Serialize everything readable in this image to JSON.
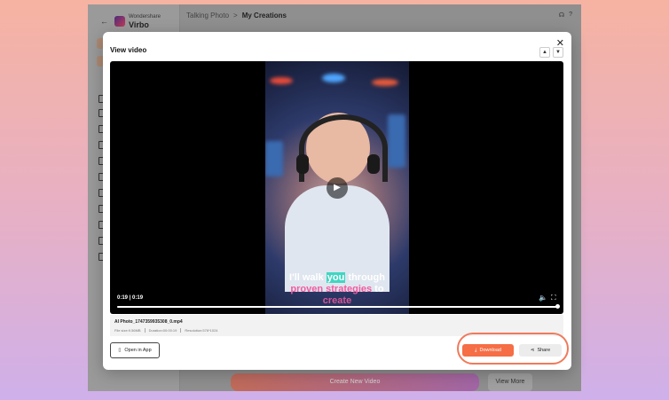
{
  "app": {
    "brand_line1": "Wondershare",
    "brand_line2": "Virbo",
    "back_icon": "arrow-left-icon",
    "breadcrumb": [
      "Talking Photo",
      ">",
      "My Creations"
    ],
    "top_icons": [
      "headset-icon",
      "help-icon"
    ]
  },
  "bottom": {
    "create_label": "Create New Video",
    "more_label": "View More"
  },
  "modal": {
    "title": "View video",
    "close_icon": "close-icon",
    "feedback_icons": [
      "thumb-up-icon",
      "thumb-down-icon"
    ],
    "player": {
      "time_current": "0:19",
      "time_separator": "|",
      "time_total": "0:19",
      "progress": 1.0,
      "caption_line1_pre": "I'll walk ",
      "caption_line1_highlight": "you",
      "caption_line1_post": " through",
      "caption_line2_pink": "proven strategies",
      "caption_line2_white": " to",
      "caption_line3": "create",
      "play_icon": "play-icon",
      "volume_icon": "volume-icon",
      "fullscreen_icon": "fullscreen-icon"
    },
    "file": {
      "name": "AI Photo_1747359935308_0.mp4",
      "size": "File size:9.56MB",
      "duration": "Duration:00:00:19",
      "resolution": "Resolution:576*1024"
    },
    "open_in_app_label": "Open in App",
    "download_label": "Download",
    "share_label": "Share"
  },
  "colors": {
    "accent": "#f56e45",
    "highlight_teal": "#41d6c2",
    "caption_pink": "#f45aa0"
  }
}
